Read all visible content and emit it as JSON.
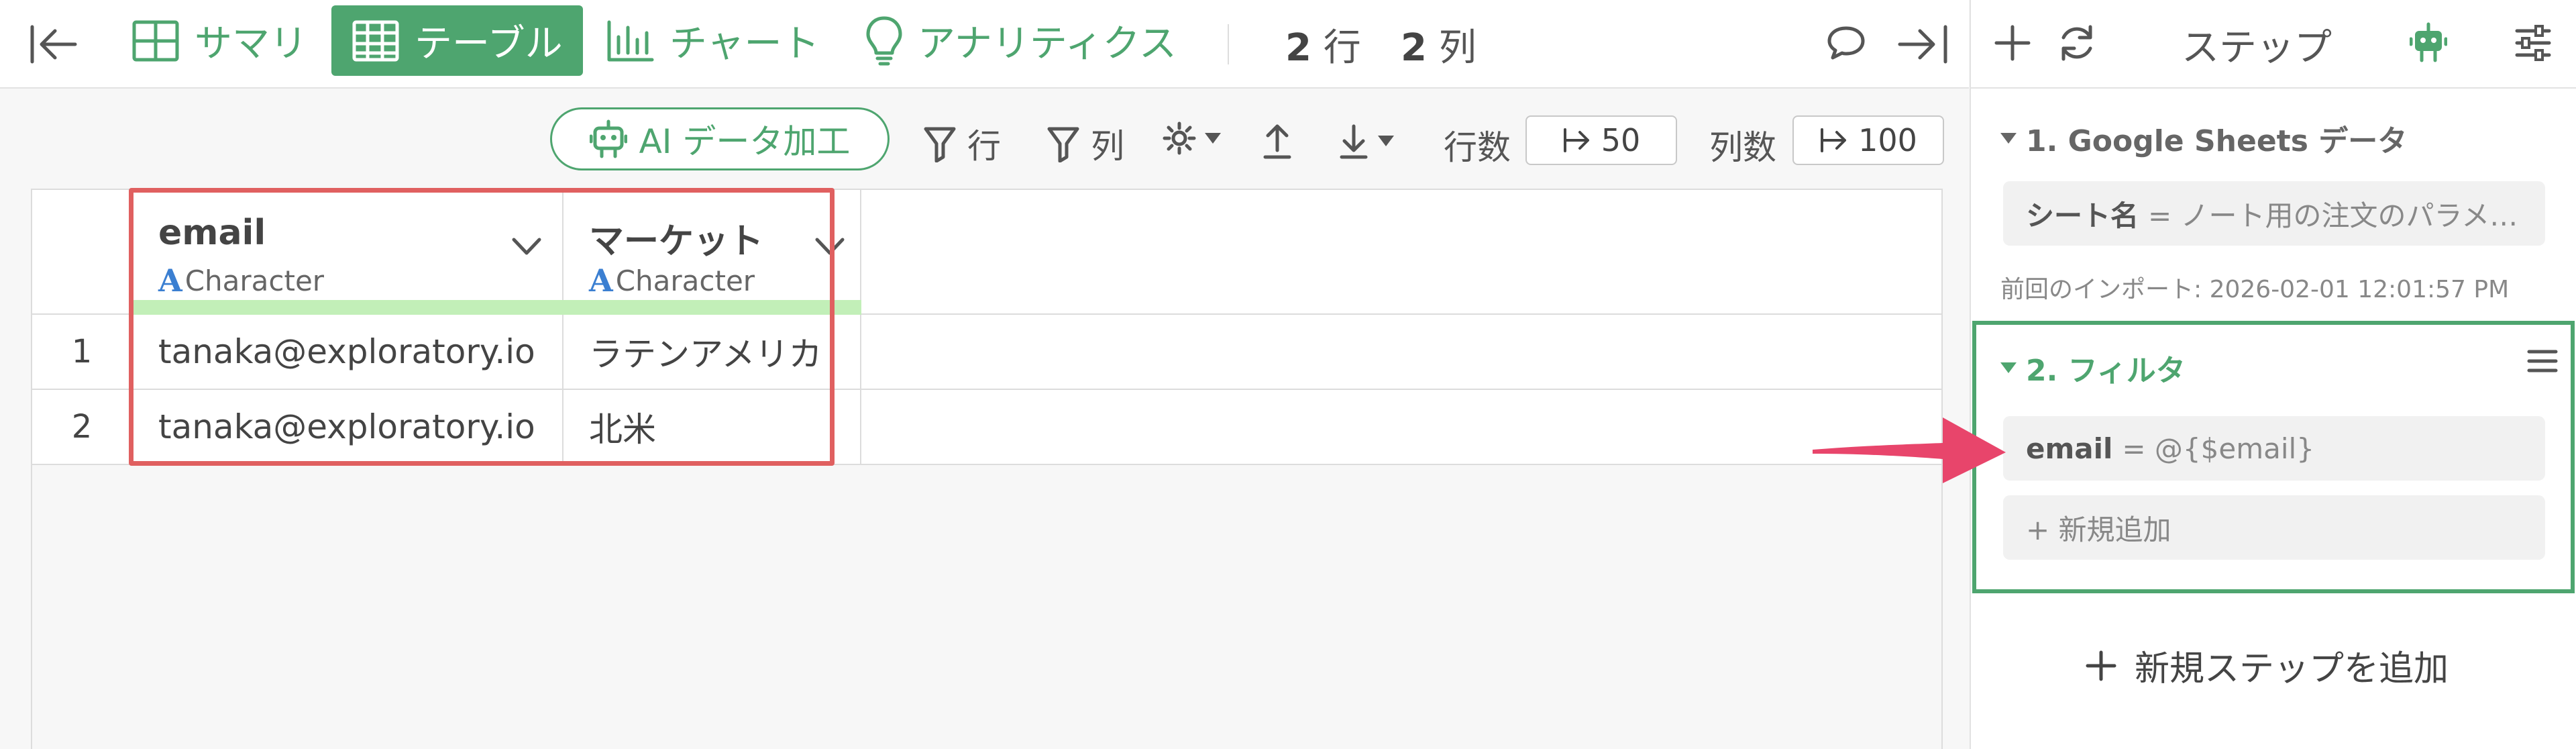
{
  "toolbar": {
    "tabs": [
      {
        "label": "サマリ"
      },
      {
        "label": "テーブル"
      },
      {
        "label": "チャート"
      },
      {
        "label": "アナリティクス"
      }
    ],
    "rows_count": "2",
    "rows_unit": "行",
    "cols_count": "2",
    "cols_unit": "列"
  },
  "subtoolbar": {
    "ai_button": "AI データ加工",
    "filter_rows": "行",
    "filter_cols": "列",
    "rows_label": "行数",
    "rows_value": "50",
    "cols_label": "列数",
    "cols_value": "100"
  },
  "table": {
    "columns": [
      {
        "name": "email",
        "type": "Character"
      },
      {
        "name": "マーケット",
        "type": "Character"
      }
    ],
    "rows": [
      {
        "num": "1",
        "cells": [
          "tanaka@exploratory.io",
          "ラテンアメリカ"
        ]
      },
      {
        "num": "2",
        "cells": [
          "tanaka@exploratory.io",
          "北米"
        ]
      }
    ]
  },
  "panel": {
    "title": "ステップ",
    "steps": [
      {
        "title": "1. Google Sheets データ",
        "param_key": "シート名",
        "param_value": "= ノート用の注文のパラメ…",
        "note": "前回のインポート: 2026-02-01 12:01:57 PM"
      },
      {
        "title": "2. フィルタ",
        "param_key": "email",
        "param_value": "= @{$email}",
        "add_label": "+ 新規追加"
      }
    ],
    "add_step_label": "新規ステップを追加"
  },
  "colors": {
    "accent": "#4ea56f",
    "highlight": "#e06060",
    "arrow": "#e8456b",
    "type_icon": "#3b7fd1"
  }
}
